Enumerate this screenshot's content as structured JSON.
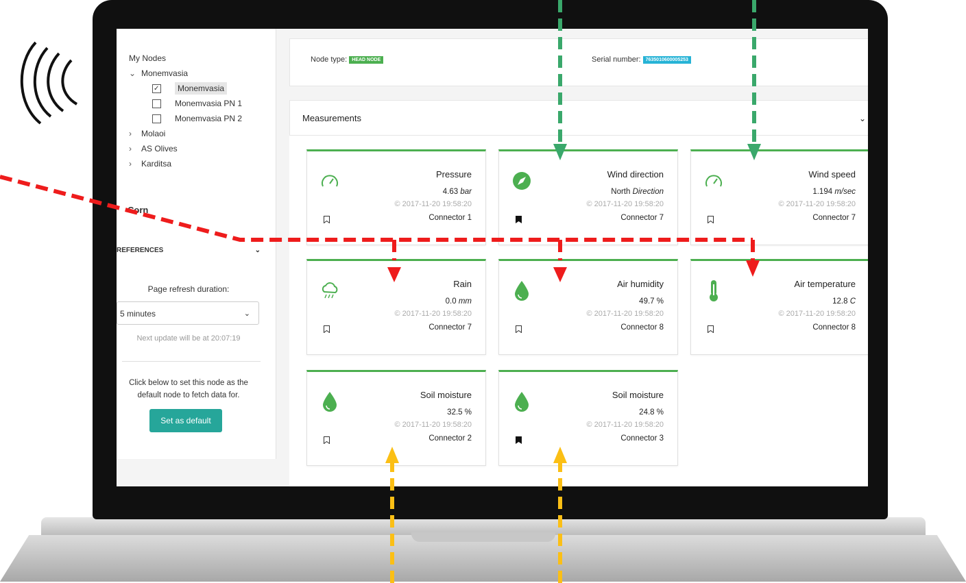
{
  "sidebar": {
    "tree": {
      "header": "My Nodes",
      "group": "Monemvasia",
      "children": [
        "Monemvasia",
        "Monemvasia PN 1",
        "Monemvasia PN 2"
      ],
      "others": [
        "Molaoi",
        "AS Olives",
        "Karditsa"
      ],
      "overlay_label": "Corn"
    },
    "preferences_header": "REFERENCES",
    "refresh_label": "Page refresh duration:",
    "refresh_value": "5 minutes",
    "next_update": "Next update will be at 20:07:19",
    "default_text": "Click below to set this node as the default node to fetch data for.",
    "default_button": "Set as default"
  },
  "node": {
    "type_label": "Node type:",
    "type_badge": "HEAD NODE",
    "serial_label": "Serial number:",
    "serial_value": "7635010600005253"
  },
  "measurements": {
    "header": "Measurements",
    "cards": [
      {
        "title": "Pressure",
        "value": "4.63",
        "unit": "bar",
        "timestamp": "© 2017-11-20 19:58:20",
        "connector": "Connector 1",
        "icon": "gauge-icon",
        "bookmarked": false
      },
      {
        "title": "Wind direction",
        "value": "North",
        "unit": "Direction",
        "timestamp": "© 2017-11-20 19:58:20",
        "connector": "Connector 7",
        "icon": "compass-icon",
        "bookmarked": true
      },
      {
        "title": "Wind speed",
        "value": "1.194",
        "unit": "m/sec",
        "timestamp": "© 2017-11-20 19:58:20",
        "connector": "Connector 7",
        "icon": "gauge-icon",
        "bookmarked": false
      },
      {
        "title": "Rain",
        "value": "0.0",
        "unit": "mm",
        "timestamp": "© 2017-11-20 19:58:20",
        "connector": "Connector 7",
        "icon": "rain-cloud-icon",
        "bookmarked": false
      },
      {
        "title": "Air humidity",
        "value": "49.7",
        "unit": "%",
        "timestamp": "© 2017-11-20 19:58:20",
        "connector": "Connector 8",
        "icon": "drop-icon",
        "bookmarked": false
      },
      {
        "title": "Air temperature",
        "value": "12.8",
        "unit": "C",
        "timestamp": "© 2017-11-20 19:58:20",
        "connector": "Connector 8",
        "icon": "thermometer-icon",
        "bookmarked": false
      },
      {
        "title": "Soil moisture",
        "value": "32.5",
        "unit": "%",
        "timestamp": "© 2017-11-20 19:58:20",
        "connector": "Connector 2",
        "icon": "drop-icon",
        "bookmarked": false
      },
      {
        "title": "Soil moisture",
        "value": "24.8",
        "unit": "%",
        "timestamp": "© 2017-11-20 19:58:20",
        "connector": "Connector 3",
        "icon": "drop-icon",
        "bookmarked": true
      }
    ]
  },
  "colors": {
    "accent": "#4caf50",
    "teal_button": "#26a69a",
    "serial_badge": "#26b3d6",
    "arrow_red": "#ee1c1c",
    "arrow_green": "#3aa86b",
    "arrow_yellow": "#fbbf15"
  }
}
